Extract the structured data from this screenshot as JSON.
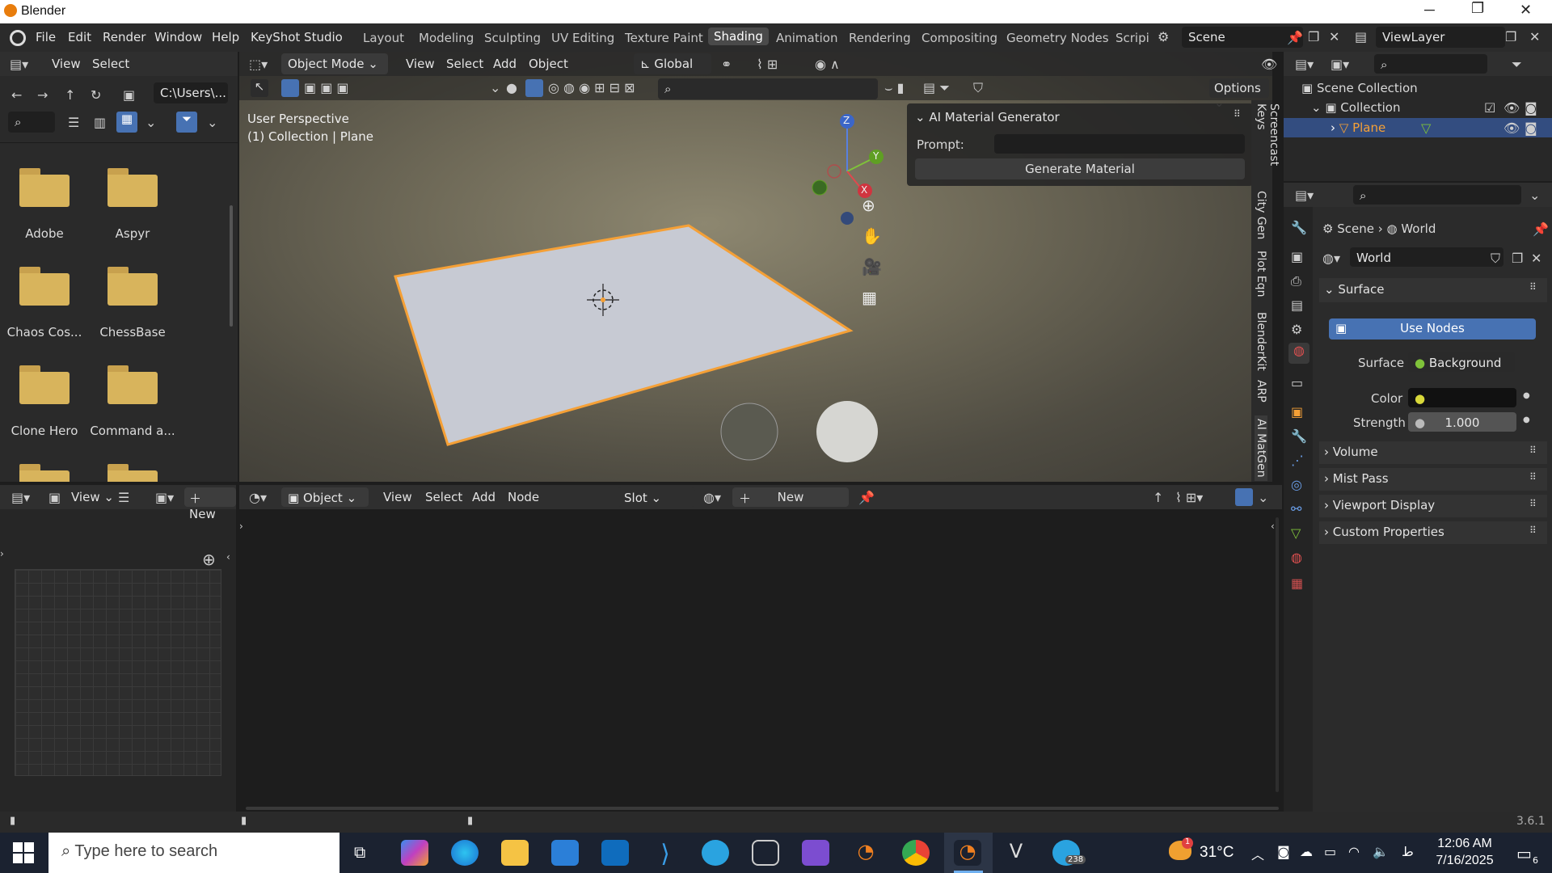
{
  "window": {
    "title": "Blender"
  },
  "menu": [
    "File",
    "Edit",
    "Render",
    "Window",
    "Help",
    "KeyShot Studio"
  ],
  "workspaces": [
    "Layout",
    "Modeling",
    "Sculpting",
    "UV Editing",
    "Texture Paint",
    "Shading",
    "Animation",
    "Rendering",
    "Compositing",
    "Geometry Nodes",
    "Scripi"
  ],
  "active_workspace": "Shading",
  "scene": {
    "label": "Scene",
    "view_layer": "ViewLayer"
  },
  "file_browser": {
    "menu": [
      "View",
      "Select"
    ],
    "path": "C:\\Users\\...",
    "folders": [
      "Adobe",
      "Aspyr",
      "Chaos Cos...",
      "ChessBase",
      "Clone Hero",
      "Command a..."
    ]
  },
  "viewport": {
    "mode": "Object Mode",
    "menu": [
      "View",
      "Select",
      "Add",
      "Object"
    ],
    "transform": "Global",
    "options": "Options",
    "perspective": "User Perspective",
    "context": "(1) Collection | Plane",
    "gizmo": {
      "x": "X",
      "y": "Y",
      "z": "Z"
    }
  },
  "ai_panel": {
    "title": "AI Material Generator",
    "prompt_label": "Prompt:",
    "prompt_value": "",
    "button": "Generate Material"
  },
  "side_tabs": [
    "Screencast Keys",
    "City Gen",
    "Plot Eqn",
    "BlenderKit",
    "ARP",
    "AI MatGen"
  ],
  "outliner": {
    "root": "Scene Collection",
    "collection": "Collection",
    "object": "Plane"
  },
  "properties": {
    "breadcrumb": [
      "Scene",
      "World"
    ],
    "world_name": "World",
    "surface_section": "Surface",
    "use_nodes": "Use Nodes",
    "surface_label": "Surface",
    "surface_value": "Background",
    "color_label": "Color",
    "strength_label": "Strength",
    "strength_value": "1.000",
    "sections": [
      "Volume",
      "Mist Pass",
      "Viewport Display",
      "Custom Properties"
    ]
  },
  "image_editor": {
    "menu": [
      "View"
    ],
    "new": "New"
  },
  "node_editor": {
    "mode": "Object",
    "menu": [
      "View",
      "Select",
      "Add",
      "Node"
    ],
    "slot": "Slot",
    "new": "New"
  },
  "status": {
    "version": "3.6.1"
  },
  "taskbar": {
    "search_placeholder": "Type here to search",
    "weather": "31°C",
    "time": "12:06 AM",
    "date": "7/16/2025",
    "telegram_badge": "238",
    "notif_count": "6",
    "weather_badge": "1"
  },
  "colors": {
    "accent": "#4772b3",
    "selection": "#f5a036",
    "folder": "#d8b45c",
    "bg": "#303030"
  }
}
